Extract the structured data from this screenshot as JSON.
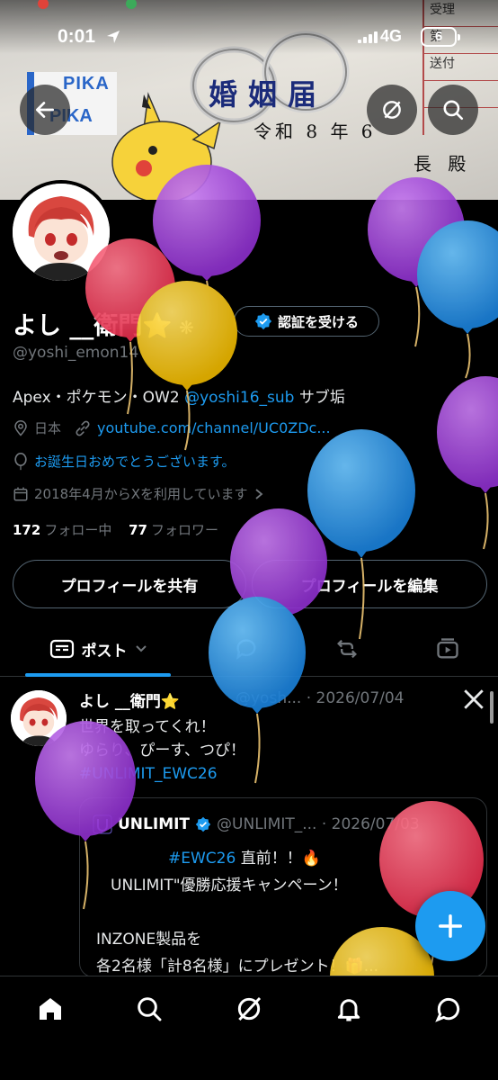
{
  "status_bar": {
    "time": "0:01",
    "network": "4G",
    "battery": "6"
  },
  "banner": {
    "pika_line1": "PIKA",
    "pika_line2": "PIKA",
    "doc_title": "婚姻届",
    "doc_date": "令和 8 年 6",
    "doc_choden": "長 殿",
    "doc_grid": [
      "受理",
      "第",
      "送付",
      ""
    ]
  },
  "profile": {
    "name": "よし __衛門",
    "name_emoji": "⭐",
    "verify_button": "認証を受ける",
    "handle": "@yoshi_emon14",
    "bio_prefix": "Apex・ポケモン・OW2 ",
    "bio_link": "@yoshi16_sub",
    "bio_suffix": " サブ垢",
    "location": "日本",
    "url": "youtube.com/channel/UC0ZDc...",
    "birthday_message": "お誕生日おめでとうございます。",
    "joined": "2018年4月からXを利用しています",
    "following_count": "172",
    "following_label": "フォロー中",
    "followers_count": "77",
    "followers_label": "フォロワー"
  },
  "actions": {
    "share_profile": "プロフィールを共有",
    "edit_profile": "プロフィールを編集"
  },
  "tabs": {
    "posts_label": "ポスト"
  },
  "tweet": {
    "author": "よし __衛門⭐",
    "handle_date": "@yosh... · 2026/07/04",
    "line1": "世界を取ってくれ！",
    "line2": "ゆらり、ぴーす、つぴ！",
    "hashtag": "#UNLIMIT_EWC26",
    "quote": {
      "name": "UNLIMIT",
      "handle_date": "@UNLIMIT_... · 2026/07/03",
      "hashtag": "#EWC26",
      "line1_rest": " 直前！！🔥",
      "line2": "UNLIMIT\"優勝応援キャンペーン！",
      "line3": "INZONE製品を",
      "line4": "各2名様「計8名様」にプレゼント！🎁..."
    }
  },
  "colors": {
    "accent": "#1d9bf0",
    "background": "#000000",
    "muted": "#71767b",
    "border": "#2f3336"
  }
}
